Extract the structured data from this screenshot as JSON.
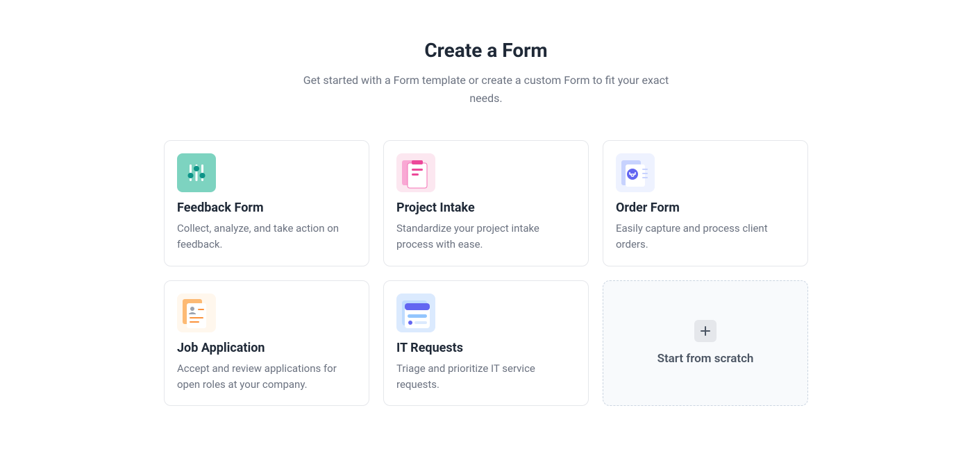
{
  "header": {
    "title": "Create a Form",
    "subtitle": "Get started with a Form template or create a custom Form to fit your exact needs."
  },
  "templates": [
    {
      "title": "Feedback Form",
      "description": "Collect, analyze, and take action on feedback."
    },
    {
      "title": "Project Intake",
      "description": "Standardize your project intake process with ease."
    },
    {
      "title": "Order Form",
      "description": "Easily capture and process client orders."
    },
    {
      "title": "Job Application",
      "description": "Accept and review applications for open roles at your company."
    },
    {
      "title": "IT Requests",
      "description": "Triage and prioritize IT service requests."
    }
  ],
  "scratch": {
    "label": "Start from scratch"
  }
}
